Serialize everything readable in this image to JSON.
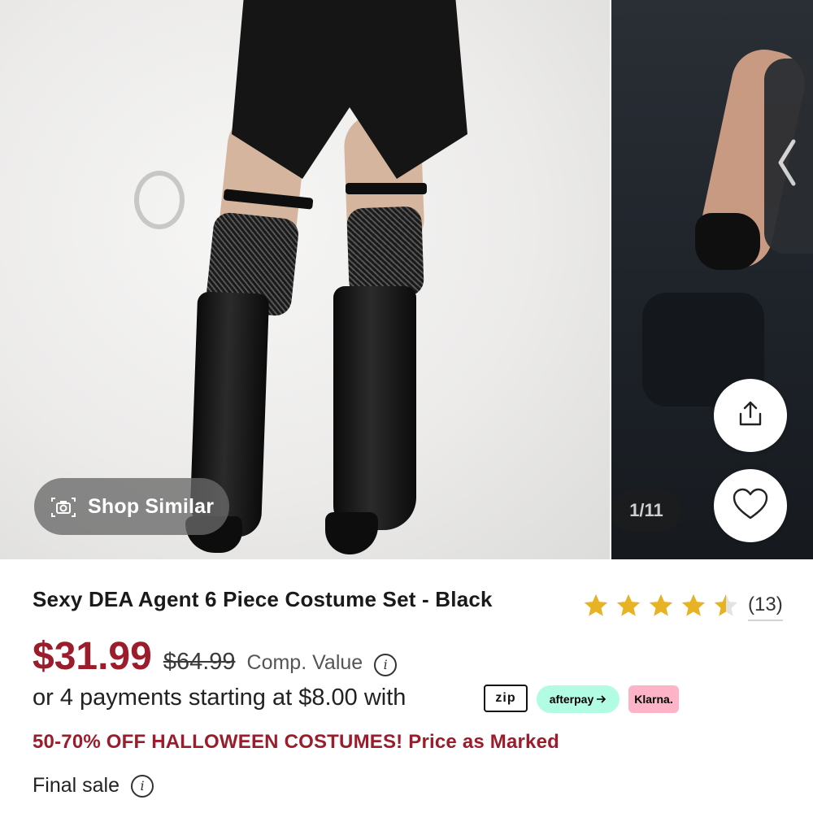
{
  "gallery": {
    "counter": "1/11",
    "shop_similar_label": "Shop Similar",
    "icons": [
      "camera-icon",
      "share-icon",
      "heart-icon",
      "chevron-left-icon"
    ]
  },
  "product": {
    "title": "Sexy DEA Agent 6 Piece Costume Set - Black",
    "rating": {
      "stars": 4.5,
      "max": 5,
      "count_label": "(13)"
    },
    "price": {
      "current": "$31.99",
      "original": "$64.99",
      "comp_value_label": "Comp. Value"
    },
    "payments": {
      "text": "or 4 payments starting at $8.00 with",
      "providers": [
        "zip",
        "afterpay",
        "Klarna."
      ]
    },
    "promo": "50-70% OFF HALLOWEEN COSTUMES! Price as Marked",
    "final_sale": "Final sale"
  },
  "colors": {
    "price_red": "#9b1c2a",
    "star_gold": "#e8b225",
    "afterpay_mint": "#b2fce4",
    "klarna_pink": "#ffb3c7"
  }
}
